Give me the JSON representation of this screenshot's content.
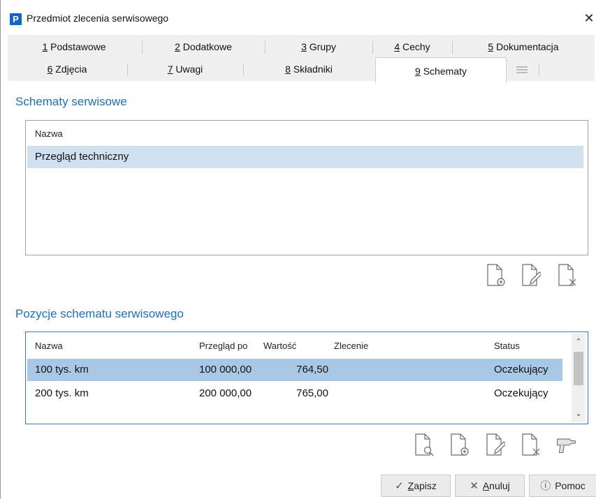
{
  "window": {
    "title": "Przedmiot zlecenia serwisowego",
    "app_icon_letter": "P",
    "close_glyph": "✕"
  },
  "tabs": {
    "row1": [
      {
        "num": "1",
        "label": " Podstawowe"
      },
      {
        "num": "2",
        "label": " Dodatkowe"
      },
      {
        "num": "3",
        "label": " Grupy"
      },
      {
        "num": "4",
        "label": " Cechy"
      },
      {
        "num": "5",
        "label": " Dokumentacja"
      }
    ],
    "row2": [
      {
        "num": "6",
        "label": " Zdjęcia"
      },
      {
        "num": "7",
        "label": " Uwagi"
      },
      {
        "num": "8",
        "label": " Składniki"
      },
      {
        "num": "9",
        "label": " Schematy"
      }
    ],
    "active": "9 Schematy",
    "more_icon": "menu-lines-icon"
  },
  "schemes": {
    "title": "Schematy serwisowe",
    "column_name": "Nazwa",
    "rows": [
      {
        "name": "Przegląd techniczny",
        "selected": true
      }
    ],
    "actions": [
      "add-document-icon",
      "edit-document-icon",
      "delete-document-icon"
    ]
  },
  "positions": {
    "title": "Pozycje schematu serwisowego",
    "columns": {
      "name": "Nazwa",
      "review_after": "Przegląd po",
      "value": "Wartość",
      "order": "Zlecenie",
      "status": "Status"
    },
    "rows": [
      {
        "name": "100 tys. km",
        "review_after": "100 000,00",
        "value": "764,50",
        "order": "",
        "status": "Oczekujący",
        "selected": true
      },
      {
        "name": "200 tys. km",
        "review_after": "200 000,00",
        "value": "765,00",
        "order": "",
        "status": "Oczekujący",
        "selected": false
      }
    ],
    "actions": [
      "preview-document-icon",
      "add-document-icon",
      "edit-document-icon",
      "delete-document-icon",
      "drill-icon"
    ]
  },
  "footer": {
    "save_label_u": "Z",
    "save_label_rest": "apisz",
    "cancel_label_u": "A",
    "cancel_label_rest": "nuluj",
    "help_label": "Pomoc"
  },
  "colors": {
    "accent": "#1f6fb5",
    "selected_row": "#cfe0f1",
    "selected_row_strong": "#a9c8e6"
  }
}
